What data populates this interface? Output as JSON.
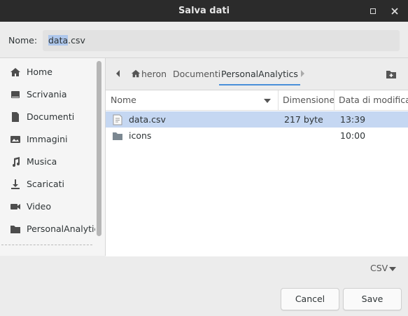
{
  "window": {
    "title": "Salva dati"
  },
  "name_field": {
    "label": "Nome:",
    "value_selected": "data",
    "value_rest": ".csv"
  },
  "sidebar": {
    "items": [
      {
        "label": "Home",
        "icon": "home-icon"
      },
      {
        "label": "Scrivania",
        "icon": "desktop-icon"
      },
      {
        "label": "Documenti",
        "icon": "document-icon"
      },
      {
        "label": "Immagini",
        "icon": "image-icon"
      },
      {
        "label": "Musica",
        "icon": "music-icon"
      },
      {
        "label": "Scaricati",
        "icon": "download-icon"
      },
      {
        "label": "Video",
        "icon": "video-icon"
      },
      {
        "label": "PersonalAnalytics",
        "icon": "folder-icon"
      }
    ]
  },
  "pathbar": {
    "crumbs": [
      "heron",
      "Documenti",
      "PersonalAnalytics"
    ]
  },
  "file_list": {
    "columns": [
      "Nome",
      "Dimensione",
      "Data di modifica"
    ],
    "rows": [
      {
        "name": "data.csv",
        "size": "217 byte",
        "modified": "13:39",
        "icon": "text-file-icon"
      },
      {
        "name": "icons",
        "size": "",
        "modified": "10:00",
        "icon": "folder-icon"
      }
    ]
  },
  "filter": {
    "value": "CSV"
  },
  "buttons": {
    "cancel": "Cancel",
    "save": "Save"
  },
  "colors": {
    "accent": "#4a90d9",
    "selection": "#c5d7f2",
    "titlebar": "#2b2b2b"
  }
}
